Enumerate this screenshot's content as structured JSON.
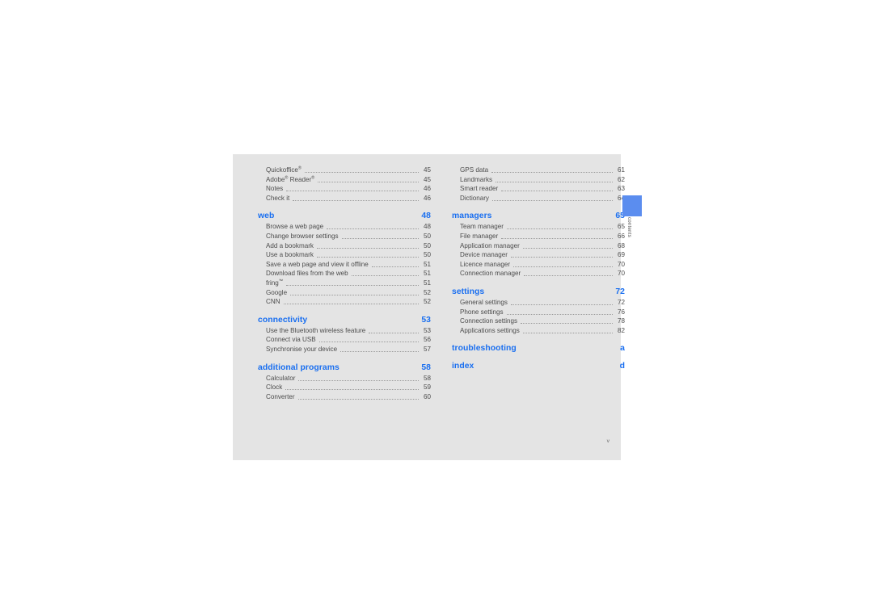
{
  "page": {
    "folio": "v",
    "side_tab_label": "contents",
    "accent_color": "#1a6ff0",
    "tab_color": "#5b8def",
    "sheet_color": "#e4e4e4"
  },
  "columns": [
    {
      "name": "left",
      "blocks": [
        {
          "type": "entries",
          "entries": [
            {
              "title": "Quickoffice",
              "sup": "reg",
              "page": "45"
            },
            {
              "title": "Adobe",
              "sup": "reg",
              "title2": " Reader",
              "sup2": "reg",
              "page": "45"
            },
            {
              "title": "Notes",
              "page": "46"
            },
            {
              "title": "Check it",
              "page": "46"
            }
          ]
        },
        {
          "type": "section",
          "heading": "web",
          "heading_page": "48",
          "entries": [
            {
              "title": "Browse a web page",
              "page": "48"
            },
            {
              "title": "Change browser settings",
              "page": "50"
            },
            {
              "title": "Add a bookmark",
              "page": "50"
            },
            {
              "title": "Use a bookmark",
              "page": "50"
            },
            {
              "title": "Save a web page and view it offline",
              "page": "51"
            },
            {
              "title": "Download files from the web",
              "page": "51"
            },
            {
              "title": "fring",
              "sup": "tm",
              "page": "51"
            },
            {
              "title": "Google",
              "page": "52"
            },
            {
              "title": "CNN",
              "page": "52"
            }
          ]
        },
        {
          "type": "section",
          "heading": "connectivity",
          "heading_page": "53",
          "entries": [
            {
              "title": "Use the Bluetooth wireless feature",
              "page": "53"
            },
            {
              "title": "Connect via USB",
              "page": "56"
            },
            {
              "title": "Synchronise your device",
              "page": "57"
            }
          ]
        },
        {
          "type": "section",
          "heading": "additional programs",
          "heading_page": "58",
          "entries": [
            {
              "title": "Calculator",
              "page": "58"
            },
            {
              "title": "Clock",
              "page": "59"
            },
            {
              "title": "Converter",
              "page": "60"
            }
          ]
        }
      ]
    },
    {
      "name": "right",
      "blocks": [
        {
          "type": "entries",
          "entries": [
            {
              "title": "GPS data",
              "page": "61"
            },
            {
              "title": "Landmarks",
              "page": "62"
            },
            {
              "title": "Smart reader",
              "page": "63"
            },
            {
              "title": "Dictionary",
              "page": "64"
            }
          ]
        },
        {
          "type": "section",
          "heading": "managers",
          "heading_page": "65",
          "entries": [
            {
              "title": "Team manager",
              "page": "65"
            },
            {
              "title": "File manager",
              "page": "66"
            },
            {
              "title": "Application manager",
              "page": "68"
            },
            {
              "title": "Device manager",
              "page": "69"
            },
            {
              "title": "Licence manager",
              "page": "70"
            },
            {
              "title": "Connection manager",
              "page": "70"
            }
          ]
        },
        {
          "type": "section",
          "heading": "settings",
          "heading_page": "72",
          "entries": [
            {
              "title": "General settings",
              "page": "72"
            },
            {
              "title": "Phone settings",
              "page": "76"
            },
            {
              "title": "Connection settings",
              "page": "78"
            },
            {
              "title": "Applications settings",
              "page": "82"
            }
          ]
        },
        {
          "type": "section",
          "heading": "troubleshooting",
          "heading_page": "a",
          "entries": []
        },
        {
          "type": "section",
          "heading": "index",
          "heading_page": "d",
          "entries": []
        }
      ]
    }
  ]
}
